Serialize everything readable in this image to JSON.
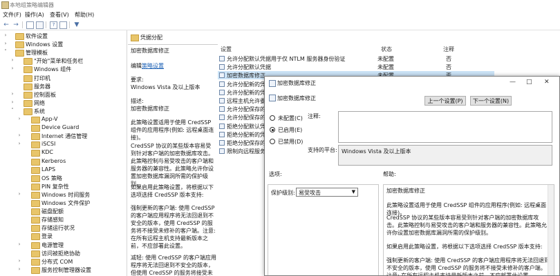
{
  "window": {
    "title": "本地组策略编辑器"
  },
  "menu": [
    "文件(F)",
    "操作(A)",
    "查看(V)",
    "帮助(H)"
  ],
  "toolbar": {
    "icons": [
      "back-icon",
      "forward-icon",
      "show-hide-tree-icon",
      "properties-icon",
      "help-icon",
      "show-hide-pane-icon",
      "filter-icon"
    ]
  },
  "tree": [
    {
      "label": "软件设置",
      "level": 1,
      "expander": ">"
    },
    {
      "label": "Windows 设置",
      "level": 1,
      "expander": ">"
    },
    {
      "label": "管理模板",
      "level": 1,
      "expander": "v"
    },
    {
      "label": "\"开始\"菜单和任务栏",
      "level": 2,
      "expander": ">"
    },
    {
      "label": "Windows 组件",
      "level": 2,
      "expander": ">"
    },
    {
      "label": "打印机",
      "level": 2,
      "expander": ""
    },
    {
      "label": "服务器",
      "level": 2,
      "expander": ""
    },
    {
      "label": "控制面板",
      "level": 2,
      "expander": ">"
    },
    {
      "label": "网络",
      "level": 2,
      "expander": ">"
    },
    {
      "label": "系统",
      "level": 2,
      "expander": "v"
    },
    {
      "label": "App-V",
      "level": 3,
      "expander": ">"
    },
    {
      "label": "Device Guard",
      "level": 3,
      "expander": ""
    },
    {
      "label": "Internet 通信管理",
      "level": 3,
      "expander": ">"
    },
    {
      "label": "iSCSI",
      "level": 3,
      "expander": ">"
    },
    {
      "label": "KDC",
      "level": 3,
      "expander": ""
    },
    {
      "label": "Kerberos",
      "level": 3,
      "expander": ""
    },
    {
      "label": "LAPS",
      "level": 3,
      "expander": ""
    },
    {
      "label": "OS 策略",
      "level": 3,
      "expander": ""
    },
    {
      "label": "PIN 复杂性",
      "level": 3,
      "expander": ""
    },
    {
      "label": "Windows 时间服务",
      "level": 3,
      "expander": ">"
    },
    {
      "label": "Windows 文件保护",
      "level": 3,
      "expander": ""
    },
    {
      "label": "磁盘配额",
      "level": 3,
      "expander": ""
    },
    {
      "label": "存储感知",
      "level": 3,
      "expander": ""
    },
    {
      "label": "存储运行状况",
      "level": 3,
      "expander": ""
    },
    {
      "label": "登录",
      "level": 3,
      "expander": ""
    },
    {
      "label": "电源管理",
      "level": 3,
      "expander": ">"
    },
    {
      "label": "访问被拒绝协助",
      "level": 3,
      "expander": ""
    },
    {
      "label": "分布式 COM",
      "level": 3,
      "expander": ">"
    },
    {
      "label": "服务控制管理器设置",
      "level": 3,
      "expander": ">"
    }
  ],
  "description_pane": {
    "folder": "凭据分配",
    "heading": "加密数据库修正",
    "edit_prefix": "编辑",
    "edit_link": "策略设置",
    "req_label": "要求:",
    "req_value": "Windows Vista 及以上版本",
    "desc_label": "描述:",
    "desc_value": "加密数据库修正",
    "p1": "此策略设置适用于使用 CredSSP 组件的应用程序(例如: 远程桌面连接)。",
    "p2": "CredSSP 协议的某些版本容易受到针对客户端的加密数据库攻击。此策略控制与易受攻击的客户端和服务器的兼容性。此策略允许你设置加密数据库漏洞所需的保护级别。",
    "p3": "如果启用此策略设置，将根据以下选项选择 CredSSP 版本支持:",
    "p4": "强制更新的客户端: 使用 CredSSP 的客户端应用程序将无法回退到不安全的版本，使用 CredSSP 的服务将不接受未修补的客户端。注意: 在所有远程主机支持最新版本之前，不应部署此设置。",
    "p5": "减轻: 使用 CredSSP 的客户端应用程序将无法回退到不安全的版本，但使用 CredSSP 的服务将接受未修补的客户端。"
  },
  "list": {
    "columns": {
      "setting": "设置",
      "state": "状态",
      "comment": "注释"
    },
    "rows": [
      {
        "name": "允许分配默认凭据用于仅 NTLM 服务器身份验证",
        "state": "未配置",
        "comment": "否",
        "selected": false
      },
      {
        "name": "允许分配默认凭据",
        "state": "未配置",
        "comment": "否",
        "selected": false
      },
      {
        "name": "加密数据库修正",
        "state": "未配置",
        "comment": "否",
        "selected": true
      },
      {
        "name": "允许分配新的凭据",
        "state": "",
        "comment": "",
        "selected": false
      },
      {
        "name": "允许分配新的凭据",
        "state": "",
        "comment": "",
        "selected": false
      },
      {
        "name": "远程主机允许委派",
        "state": "",
        "comment": "",
        "selected": false
      },
      {
        "name": "允许分配保存的凭据",
        "state": "",
        "comment": "",
        "selected": false
      },
      {
        "name": "允许分配保存的凭据",
        "state": "",
        "comment": "",
        "selected": false
      },
      {
        "name": "拒绝分配默认凭据",
        "state": "",
        "comment": "",
        "selected": false
      },
      {
        "name": "拒绝分配新的凭据",
        "state": "",
        "comment": "",
        "selected": false
      },
      {
        "name": "拒绝分配保存的凭据",
        "state": "",
        "comment": "",
        "selected": false
      },
      {
        "name": "限制向远程服务器",
        "state": "",
        "comment": "",
        "selected": false
      }
    ]
  },
  "dialog": {
    "title": "加密数据库修正",
    "subtitle": "加密数据库修正",
    "prev_btn": "上一个设置(P)",
    "next_btn": "下一个设置(N)",
    "radio_not_configured": "未配置(C)",
    "radio_enabled": "已启用(E)",
    "radio_disabled": "已禁用(D)",
    "selected_state": "enabled",
    "comment_label": "注释:",
    "platform_label": "支持的平台:",
    "platform_value": "Windows Vista 及以上版本",
    "options_label": "选项:",
    "help_label": "帮助:",
    "protect_label": "保护级别:",
    "protect_value": "易受攻击",
    "help_title": "加密数据库修正",
    "help_p1": "此策略设置适用于使用 CredSSP 组件的应用程序(例如: 远程桌面连接)。",
    "help_p2": "CredSSP 协议的某些版本容易受到针对客户端的加密数据库攻击。此策略控制与易受攻击的客户端和服务器的兼容性。此策略允许你设置加密数据库漏洞所需的保护级别。",
    "help_p3": "如果启用此策略设置，将根据以下选项选择 CredSSP 版本支持:",
    "help_p4": "强制更新的客户端: 使用 CredSSP 的客户端应用程序将无法回退到不安全的版本，使用 CredSSP 的服务将不接受未修补的客户端。注意: 在所有远程主机支持最新版本之前，不应部署此设置。"
  }
}
